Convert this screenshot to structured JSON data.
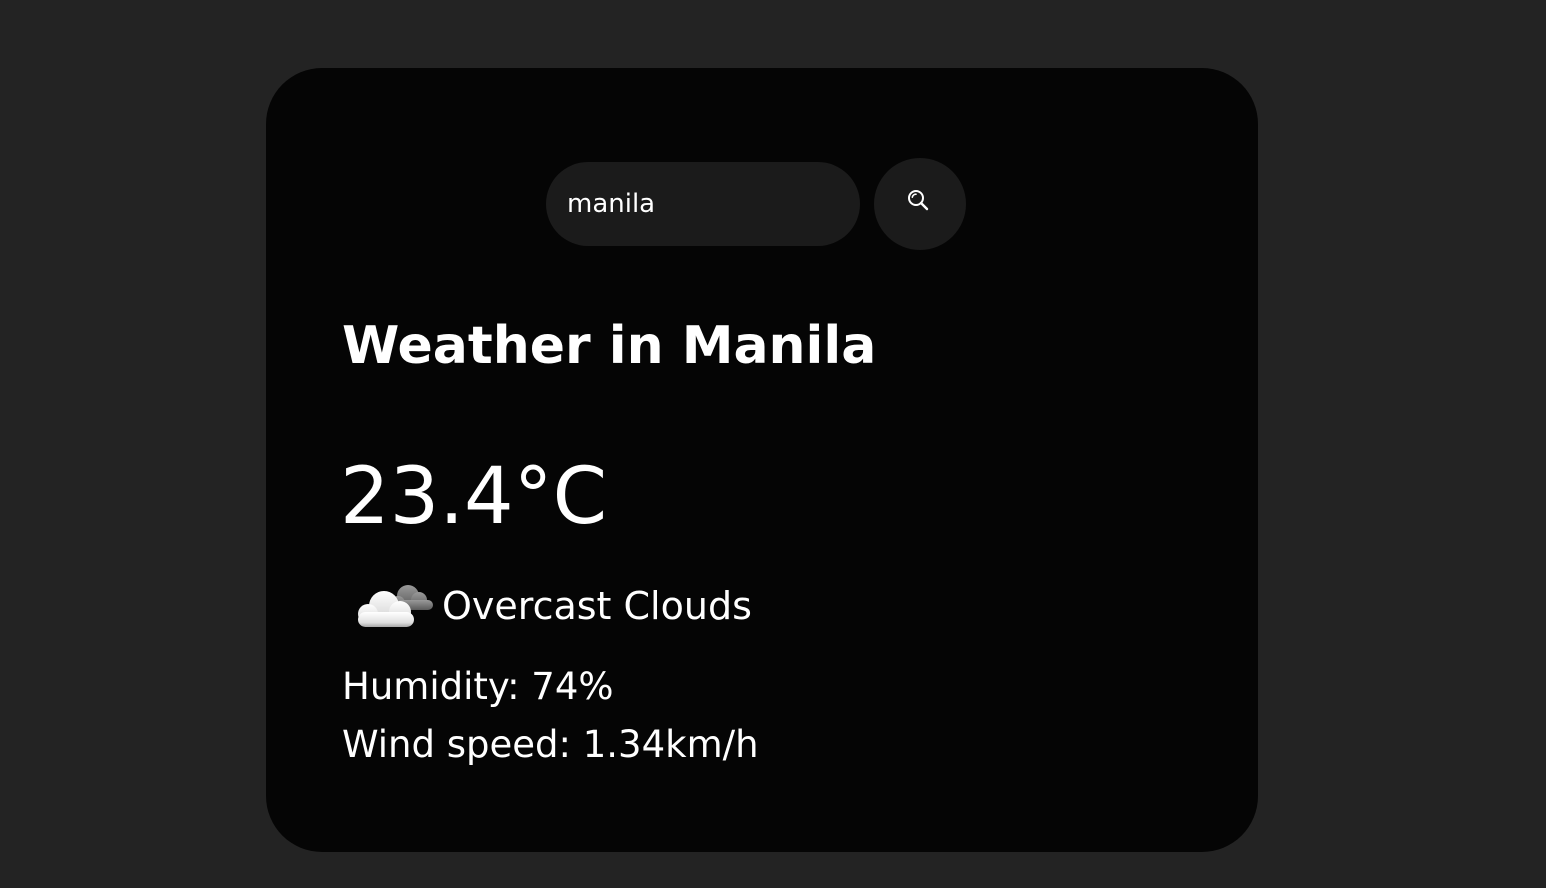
{
  "search": {
    "value": "manila",
    "icon": "search-icon"
  },
  "weather": {
    "city_heading": "Weather in Manila",
    "temperature": "23.4°C",
    "condition_icon": "overcast-clouds-icon",
    "description": "Overcast Clouds",
    "humidity": "Humidity: 74%",
    "wind_speed": "Wind speed: 1.34km/h"
  },
  "colors": {
    "page_background": "#232323",
    "card_background": "#050505",
    "control_background": "#1b1b1b",
    "text": "#ffffff"
  }
}
